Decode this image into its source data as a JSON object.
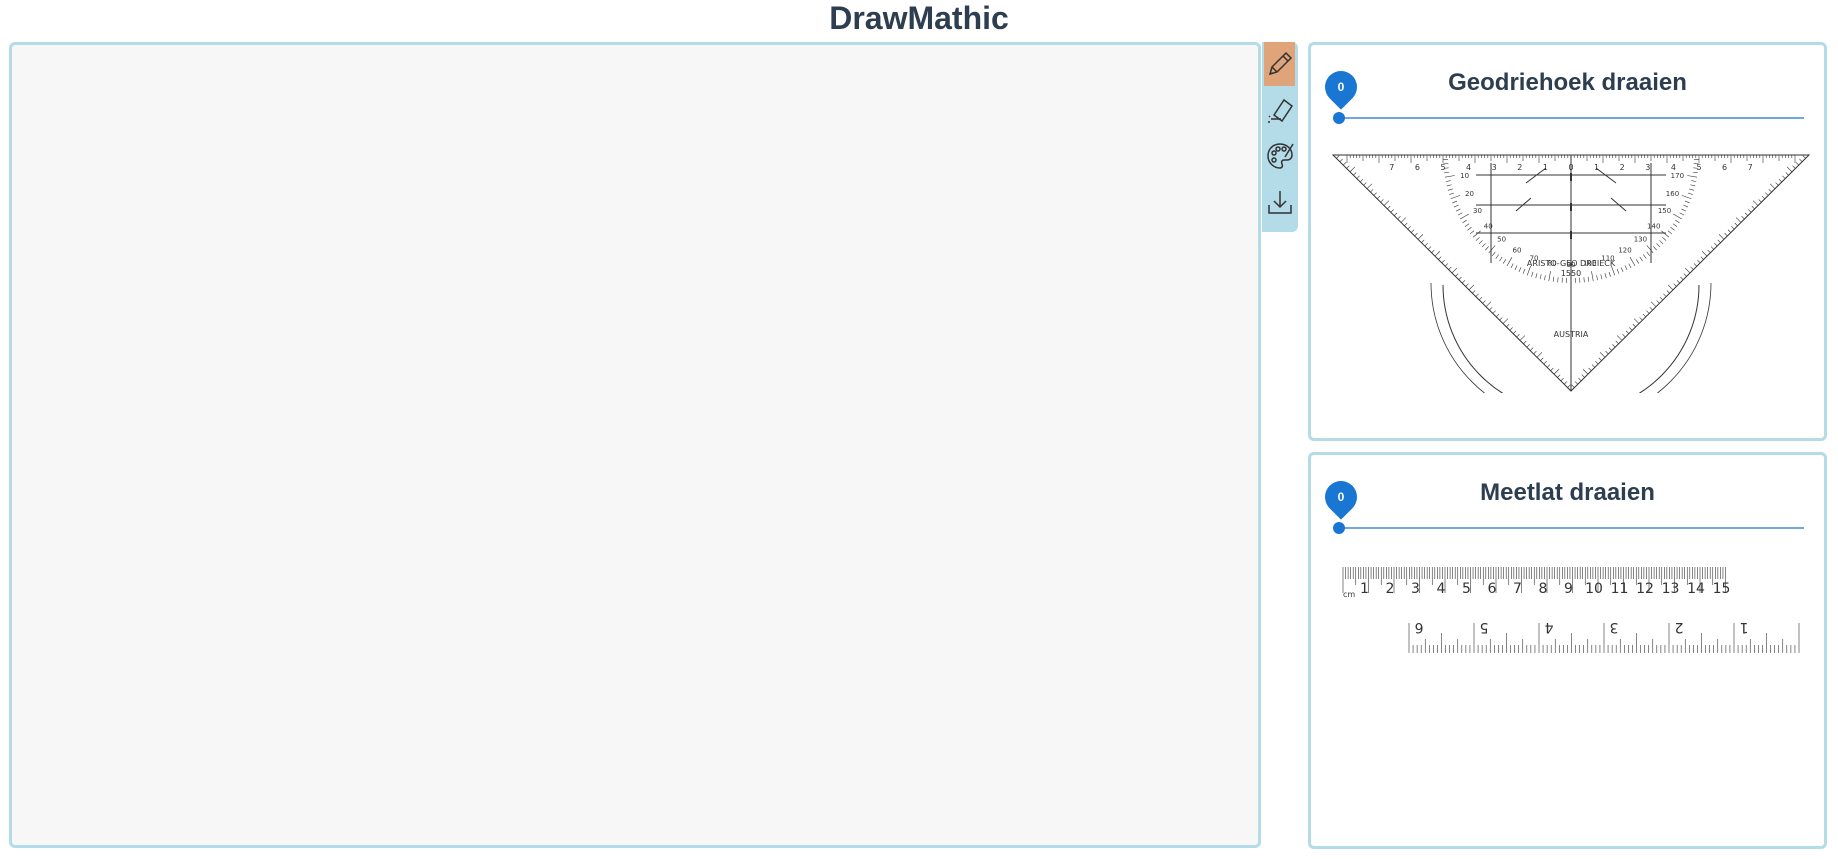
{
  "app": {
    "title": "DrawMathic"
  },
  "toolbar": {
    "tools": [
      {
        "name": "pencil",
        "icon": "pencil-icon",
        "active": true
      },
      {
        "name": "eraser",
        "icon": "eraser-icon",
        "active": false
      },
      {
        "name": "palette",
        "icon": "palette-icon",
        "active": false
      },
      {
        "name": "download",
        "icon": "download-icon",
        "active": false
      }
    ]
  },
  "geodriehoek": {
    "title": "Geodriehoek draaien",
    "rotation_value": "0",
    "ruler_labels": [
      "7",
      "6",
      "5",
      "4",
      "3",
      "2",
      "1",
      "0",
      "1",
      "2",
      "3",
      "4",
      "5",
      "6",
      "7"
    ],
    "brand_text": "ARISTO-GEO DREIECK",
    "model_text": "1550",
    "country_text": "AUSTRIA",
    "angle_labels": [
      "10",
      "20",
      "30",
      "40",
      "50",
      "60",
      "70",
      "80",
      "90",
      "100",
      "110",
      "120",
      "130",
      "140",
      "150",
      "160",
      "170"
    ]
  },
  "meetlat": {
    "title": "Meetlat draaien",
    "rotation_value": "0",
    "unit_label": "cm",
    "cm_labels": [
      "1",
      "2",
      "3",
      "4",
      "5",
      "6",
      "7",
      "8",
      "9",
      "10",
      "11",
      "12",
      "13",
      "14",
      "15"
    ],
    "inch_labels": [
      "6",
      "5",
      "4",
      "3",
      "2",
      "1"
    ]
  },
  "colors": {
    "accent": "#1976d2",
    "border": "#b3dbe8",
    "active_tool": "#e0a47a",
    "title": "#2c3e50"
  }
}
